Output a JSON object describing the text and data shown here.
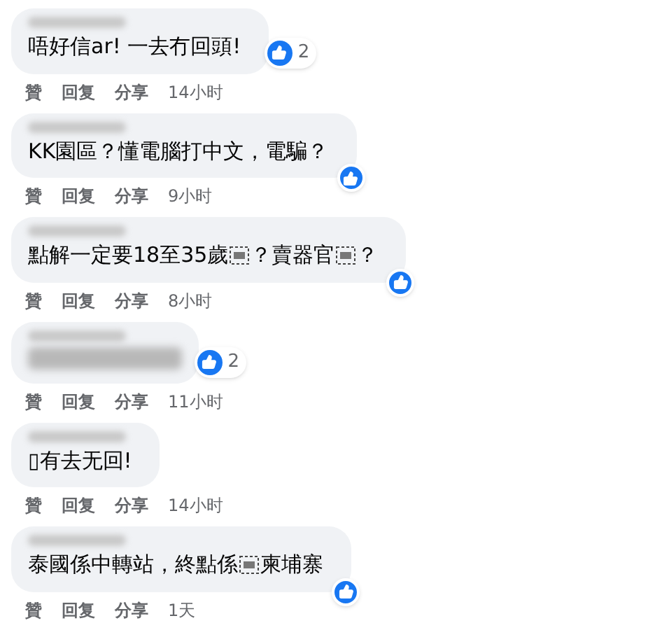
{
  "comments": [
    {
      "kind": "text",
      "parts": [
        "唔好信ar! 一去冇回頭!"
      ],
      "reactions": {
        "kind": "count",
        "count": "2"
      },
      "actions": [
        "贊",
        "回复",
        "分享"
      ],
      "time": "14小时"
    },
    {
      "kind": "text",
      "parts": [
        "KK園區？懂電腦打中文，電騙？"
      ],
      "reactions": {
        "kind": "icon"
      },
      "actions": [
        "贊",
        "回复",
        "分享"
      ],
      "time": "9小时"
    },
    {
      "kind": "text",
      "parts": [
        "點解一定要18至35歲",
        "？賣器官",
        "？"
      ],
      "reactions": {
        "kind": "icon"
      },
      "actions": [
        "贊",
        "回复",
        "分享"
      ],
      "time": "8小时"
    },
    {
      "kind": "blurred",
      "reactions": {
        "kind": "count",
        "count": "2"
      },
      "actions": [
        "贊",
        "回复",
        "分享"
      ],
      "time": "11小时"
    },
    {
      "kind": "text",
      "parts": [
        "▯有去无回!"
      ],
      "actions": [
        "贊",
        "回复",
        "分享"
      ],
      "time": "14小时"
    },
    {
      "kind": "text",
      "parts": [
        "泰國係中轉站，終點係",
        "柬埔寨"
      ],
      "reactions": {
        "kind": "icon"
      },
      "actions": [
        "贊",
        "回复",
        "分享"
      ],
      "time": "1天"
    }
  ]
}
